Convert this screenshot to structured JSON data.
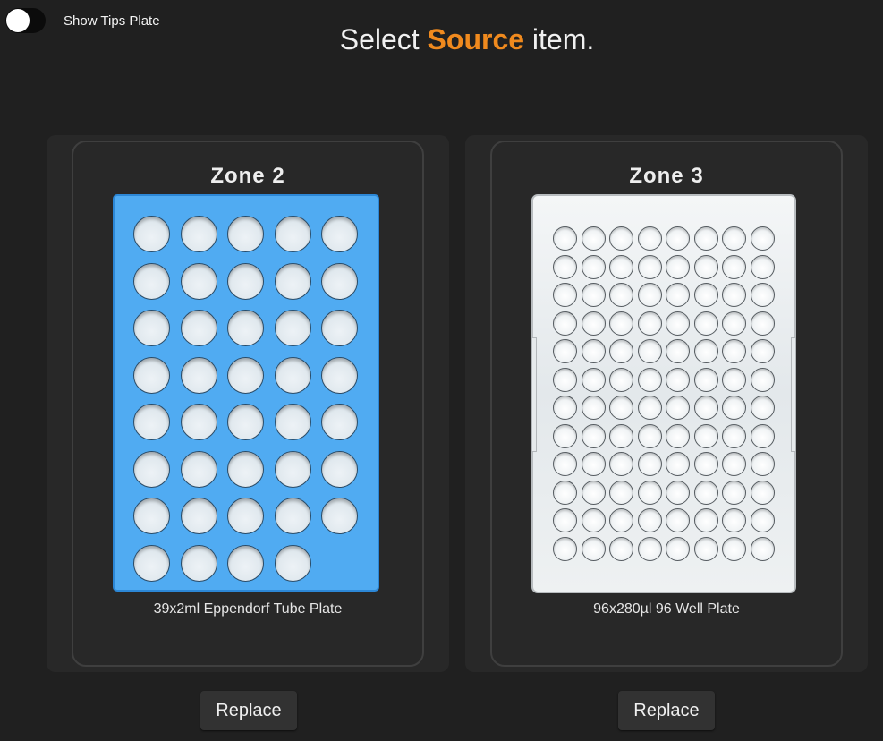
{
  "toolbar": {
    "show_tips_label": "Show Tips Plate",
    "show_tips_on": false
  },
  "header": {
    "prefix": "Select ",
    "accent": "Source",
    "suffix": " item.",
    "accent_color": "#f08a1e"
  },
  "zones": [
    {
      "title": "Zone 2",
      "plate_label": "39x2ml Eppendorf Tube Plate",
      "plate_color": "#50abf2",
      "rows": 8,
      "cols": 5,
      "well_count": 39,
      "replace_label": "Replace"
    },
    {
      "title": "Zone 3",
      "plate_label": "96x280µl 96 Well Plate",
      "plate_color": "#eef1f2",
      "rows": 12,
      "cols": 8,
      "well_count": 96,
      "replace_label": "Replace"
    }
  ]
}
